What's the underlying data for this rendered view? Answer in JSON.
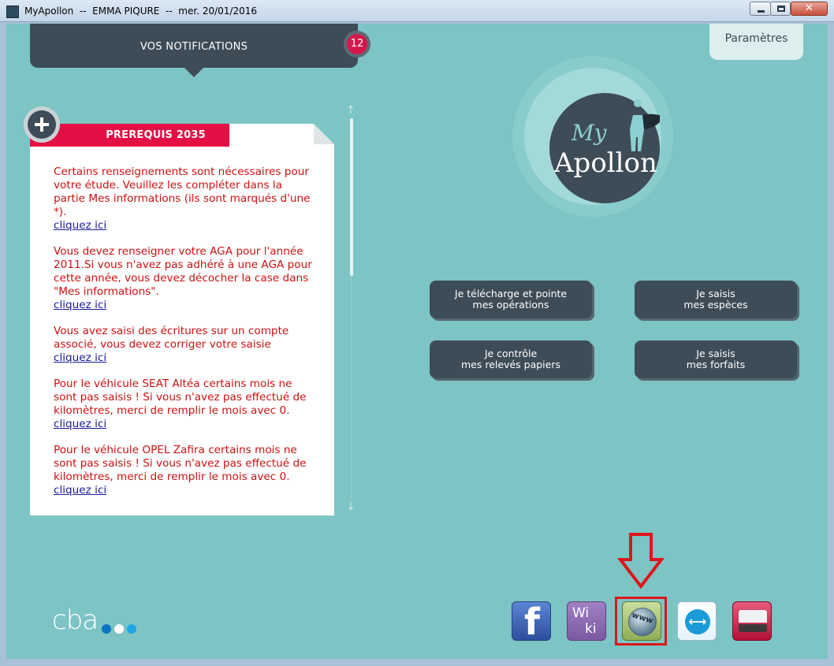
{
  "window": {
    "title": "MyApollon  --  EMMA PIQURE  --  mer. 20/01/2016",
    "close_label": "✕"
  },
  "header": {
    "notifications_label": "VOS NOTIFICATIONS",
    "notifications_count": "12",
    "params_label": "Paramètres"
  },
  "card": {
    "category": "PREREQUIS 2035",
    "notes": [
      {
        "text": "Certains renseignements sont nécessaires pour votre étude. Veuillez les compléter dans la partie Mes informations (ils sont marqués d'une *).",
        "link": "cliquez ici"
      },
      {
        "text": "Vous devez renseigner votre AGA pour l'année 2011.Si vous n'avez pas adhéré à une AGA pour cette année, vous devez décocher la case dans \"Mes informations\".",
        "link": "cliquez ici"
      },
      {
        "text": "Vous avez saisi des écritures sur un compte associé, vous devez corriger votre saisie",
        "link": "cliquez ici"
      },
      {
        "text": "Pour le véhicule SEAT Altéa certains mois ne sont pas saisis ! Si vous n'avez pas effectué de kilomètres, merci de remplir le mois avec 0.",
        "link": "cliquez ici"
      },
      {
        "text": "Pour le véhicule OPEL Zafira certains mois ne sont pas saisis ! Si vous n'avez pas effectué de kilomètres, merci de remplir le mois avec 0.",
        "link": "cliquez ici"
      }
    ]
  },
  "logo": {
    "my": "My",
    "name": "Apollon"
  },
  "actions": {
    "download": {
      "line1": "Je télécharge et pointe",
      "line2": "mes opérations"
    },
    "species": {
      "line1": "Je saisis",
      "line2": "mes espèces"
    },
    "statements": {
      "line1": "Je contrôle",
      "line2": "mes relevés papiers"
    },
    "packages": {
      "line1": "Je saisis",
      "line2": "mes forfaits"
    }
  },
  "bottom_icons": {
    "facebook": "f",
    "wiki_top": "Wi",
    "wiki_bottom": "ki",
    "www": "www",
    "teamviewer": "⟷"
  },
  "brand": {
    "name": "cba"
  },
  "colors": {
    "background": "#7dc4c4",
    "dark": "#3e4c57",
    "accent_red": "#e40f45",
    "note_text": "#cc1010",
    "highlight": "#e0141b",
    "dot1": "#0b74c4",
    "dot2": "#ffffff",
    "dot3": "#1fa5e8"
  }
}
